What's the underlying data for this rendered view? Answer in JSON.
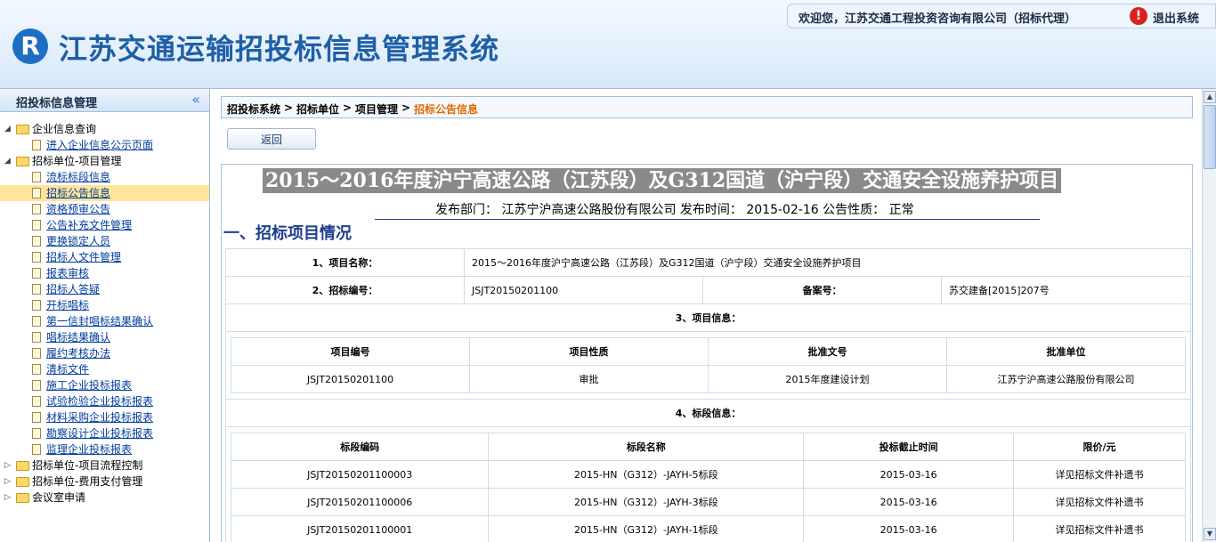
{
  "header": {
    "logo_glyph": "R",
    "system_title": "江苏交通运输招投标信息管理系统",
    "welcome": "欢迎您，江苏交通工程投资咨询有限公司（招标代理）",
    "logout_icon_glyph": "!",
    "logout_label": "退出系统"
  },
  "sidebar": {
    "title": "招投标信息管理",
    "collapse_glyph": "«",
    "tree": [
      {
        "type": "folder",
        "label": "企业信息查询",
        "expanded": true
      },
      {
        "type": "item",
        "label": "进入企业信息公示页面"
      },
      {
        "type": "folder",
        "label": "招标单位-项目管理",
        "expanded": true
      },
      {
        "type": "item",
        "label": "流标标段信息"
      },
      {
        "type": "item",
        "label": "招标公告信息",
        "selected": true
      },
      {
        "type": "item",
        "label": "资格预审公告"
      },
      {
        "type": "item",
        "label": "公告补充文件管理"
      },
      {
        "type": "item",
        "label": "更换锁定人员"
      },
      {
        "type": "item",
        "label": "招标人文件管理"
      },
      {
        "type": "item",
        "label": "报表审核"
      },
      {
        "type": "item",
        "label": "招标人答疑"
      },
      {
        "type": "item",
        "label": "开标唱标"
      },
      {
        "type": "item",
        "label": "第一信封唱标结果确认"
      },
      {
        "type": "item",
        "label": "唱标结果确认"
      },
      {
        "type": "item",
        "label": "履约考核办法"
      },
      {
        "type": "item",
        "label": "清标文件"
      },
      {
        "type": "item",
        "label": "施工企业投标报表"
      },
      {
        "type": "item",
        "label": "试验检验企业投标报表"
      },
      {
        "type": "item",
        "label": "材料采购企业投标报表"
      },
      {
        "type": "item",
        "label": "勘察设计企业投标报表"
      },
      {
        "type": "item",
        "label": "监理企业投标报表"
      },
      {
        "type": "folder",
        "label": "招标单位-项目流程控制",
        "expanded": false
      },
      {
        "type": "folder",
        "label": "招标单位-费用支付管理",
        "expanded": false
      },
      {
        "type": "folder",
        "label": "会议室申请",
        "expanded": false
      }
    ]
  },
  "breadcrumb": {
    "items": [
      "招投标系统",
      "招标单位",
      "项目管理",
      "招标公告信息"
    ],
    "separator": ">"
  },
  "back_button": "返回",
  "announcement": {
    "title": "2015～2016年度沪宁高速公路（江苏段）及G312国道（沪宁段）交通安全设施养护项目",
    "meta": "发布部门： 江苏宁沪高速公路股份有限公司 发布时间： 2015-02-16 公告性质： 正常",
    "section1": "一、招标项目情况",
    "project_name_label": "1、项目名称：",
    "project_name": "2015～2016年度沪宁高速公路（江苏段）及G312国道（沪宁段）交通安全设施养护项目",
    "bid_no_label": "2、招标编号：",
    "bid_no": "JSJT20150201100",
    "filing_label": "备案号：",
    "filing_no": "苏交建备[2015]207号",
    "project_info_label": "3、项目信息：",
    "project_table": {
      "headers": [
        "项目编号",
        "项目性质",
        "批准文号",
        "批准单位"
      ],
      "rows": [
        [
          "JSJT20150201100",
          "审批",
          "2015年度建设计划",
          "江苏宁沪高速公路股份有限公司"
        ]
      ]
    },
    "section_info_label": "4、标段信息：",
    "section_table": {
      "headers": [
        "标段编码",
        "标段名称",
        "投标截止时间",
        "限价/元"
      ],
      "rows": [
        [
          "JSJT20150201100003",
          "2015-HN（G312）-JAYH-5标段",
          "2015-03-16",
          "详见招标文件补遗书"
        ],
        [
          "JSJT20150201100006",
          "2015-HN（G312）-JAYH-3标段",
          "2015-03-16",
          "详见招标文件补遗书"
        ],
        [
          "JSJT20150201100001",
          "2015-HN（G312）-JAYH-1标段",
          "2015-03-16",
          "详见招标文件补遗书"
        ]
      ]
    }
  },
  "colors": {
    "title_blue": "#1f5fa6",
    "link_blue": "#003b9c",
    "breadcrumb_current": "#e06a00",
    "selected_bg": "#ffe49a"
  },
  "icons": {
    "tree_folder": "folder-icon",
    "tree_item": "document-icon",
    "logout": "logout-icon"
  }
}
